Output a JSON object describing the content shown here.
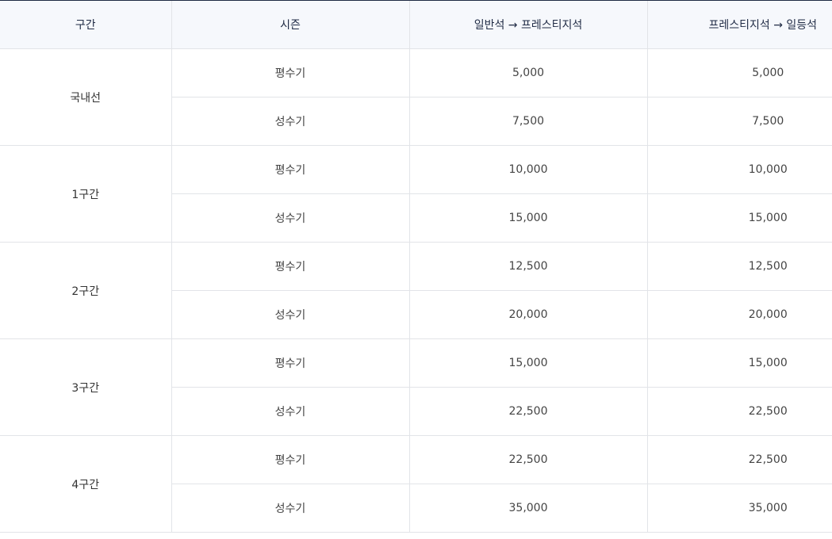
{
  "headers": [
    "구간",
    "시즌",
    "일반석 → 프레스티지석",
    "프레스티지석 → 일등석"
  ],
  "sections": [
    {
      "name": "국내선",
      "rows": [
        {
          "season": "평수기",
          "economy_to_prestige": "5,000",
          "prestige_to_first": "5,000"
        },
        {
          "season": "성수기",
          "economy_to_prestige": "7,500",
          "prestige_to_first": "7,500"
        }
      ]
    },
    {
      "name": "1구간",
      "rows": [
        {
          "season": "평수기",
          "economy_to_prestige": "10,000",
          "prestige_to_first": "10,000"
        },
        {
          "season": "성수기",
          "economy_to_prestige": "15,000",
          "prestige_to_first": "15,000"
        }
      ]
    },
    {
      "name": "2구간",
      "rows": [
        {
          "season": "평수기",
          "economy_to_prestige": "12,500",
          "prestige_to_first": "12,500"
        },
        {
          "season": "성수기",
          "economy_to_prestige": "20,000",
          "prestige_to_first": "20,000"
        }
      ]
    },
    {
      "name": "3구간",
      "rows": [
        {
          "season": "평수기",
          "economy_to_prestige": "15,000",
          "prestige_to_first": "15,000"
        },
        {
          "season": "성수기",
          "economy_to_prestige": "22,500",
          "prestige_to_first": "22,500"
        }
      ]
    },
    {
      "name": "4구간",
      "rows": [
        {
          "season": "평수기",
          "economy_to_prestige": "22,500",
          "prestige_to_first": "22,500"
        },
        {
          "season": "성수기",
          "economy_to_prestige": "35,000",
          "prestige_to_first": "35,000"
        }
      ]
    }
  ]
}
